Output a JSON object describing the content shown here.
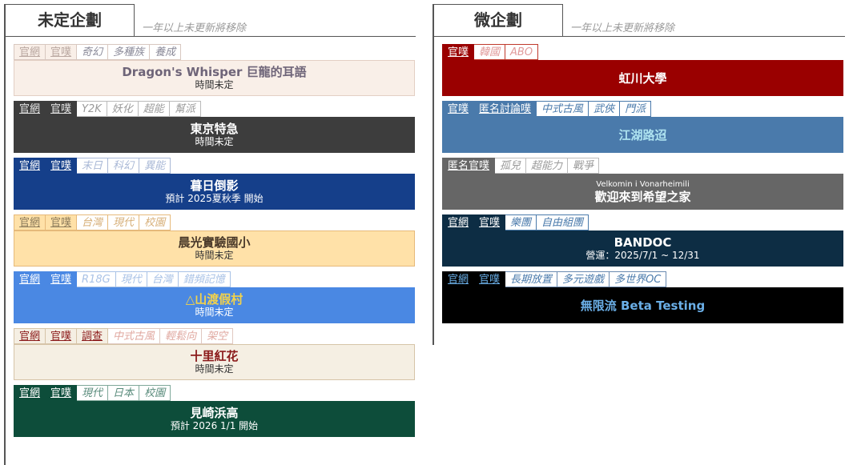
{
  "left": {
    "title": "未定企劃",
    "note": "一年以上未更新將移除",
    "cards": [
      {
        "tags": [
          {
            "label": "官網",
            "kind": "link",
            "bg": "#f9efe8",
            "fg": "#b9a7a0",
            "border": "#d8c8c0"
          },
          {
            "label": "官噗",
            "kind": "link",
            "bg": "#f9efe8",
            "fg": "#b9a7a0",
            "border": "#d8c8c0"
          },
          {
            "label": "奇幻",
            "kind": "genre",
            "bg": "#ffffff",
            "fg": "#8a8a99",
            "border": "#d8c8c0"
          },
          {
            "label": "多種族",
            "kind": "genre",
            "bg": "#ffffff",
            "fg": "#8a8a99",
            "border": "#d8c8c0"
          },
          {
            "label": "養成",
            "kind": "genre",
            "bg": "#ffffff",
            "fg": "#8a8a99",
            "border": "#d8c8c0"
          }
        ],
        "banner": {
          "bg": "#f9efe8",
          "border": "#e3cfc4",
          "title": "Dragon's Whisper 巨龍的耳語",
          "title_color": "#6e6478",
          "sub": "時間未定",
          "sub_color": "#333"
        }
      },
      {
        "tags": [
          {
            "label": "官網",
            "kind": "link",
            "bg": "#3d3d3d",
            "fg": "#e6e6e6",
            "border": "#3d3d3d"
          },
          {
            "label": "官噗",
            "kind": "link",
            "bg": "#3d3d3d",
            "fg": "#e6e6e6",
            "border": "#3d3d3d"
          },
          {
            "label": "Y2K",
            "kind": "genre",
            "bg": "#ffffff",
            "fg": "#9a9a9a",
            "border": "#bbbbbb"
          },
          {
            "label": "妖化",
            "kind": "genre",
            "bg": "#ffffff",
            "fg": "#9a9a9a",
            "border": "#bbbbbb"
          },
          {
            "label": "超能",
            "kind": "genre",
            "bg": "#ffffff",
            "fg": "#9a9a9a",
            "border": "#bbbbbb"
          },
          {
            "label": "幫派",
            "kind": "genre",
            "bg": "#ffffff",
            "fg": "#9a9a9a",
            "border": "#bbbbbb"
          }
        ],
        "banner": {
          "bg": "#3d3d3d",
          "border": "#3d3d3d",
          "title": "東京特急",
          "title_color": "#ffffff",
          "sub": "時間未定",
          "sub_color": "#ffffff"
        }
      },
      {
        "tags": [
          {
            "label": "官網",
            "kind": "link",
            "bg": "#153f8a",
            "fg": "#ffffff",
            "border": "#153f8a"
          },
          {
            "label": "官噗",
            "kind": "link",
            "bg": "#153f8a",
            "fg": "#ffffff",
            "border": "#153f8a"
          },
          {
            "label": "末日",
            "kind": "genre",
            "bg": "#ffffff",
            "fg": "#a9b8d6",
            "border": "#a9b8d6"
          },
          {
            "label": "科幻",
            "kind": "genre",
            "bg": "#ffffff",
            "fg": "#a9b8d6",
            "border": "#a9b8d6"
          },
          {
            "label": "異能",
            "kind": "genre",
            "bg": "#ffffff",
            "fg": "#a9b8d6",
            "border": "#a9b8d6"
          }
        ],
        "banner": {
          "bg": "#153f8a",
          "border": "#153f8a",
          "title": "暮日倒影",
          "title_color": "#ffffff",
          "sub": "預計 2025夏秋季 開始",
          "sub_color": "#ffffff"
        }
      },
      {
        "tags": [
          {
            "label": "官網",
            "kind": "link",
            "bg": "#ffe1a8",
            "fg": "#8a7a5a",
            "border": "#e6b97a"
          },
          {
            "label": "官噗",
            "kind": "link",
            "bg": "#ffe1a8",
            "fg": "#8a7a5a",
            "border": "#e6b97a"
          },
          {
            "label": "台灣",
            "kind": "genre",
            "bg": "#ffffff",
            "fg": "#d7b07a",
            "border": "#e6b97a"
          },
          {
            "label": "現代",
            "kind": "genre",
            "bg": "#ffffff",
            "fg": "#d7b07a",
            "border": "#e6b97a"
          },
          {
            "label": "校園",
            "kind": "genre",
            "bg": "#ffffff",
            "fg": "#d7b07a",
            "border": "#e6b97a"
          }
        ],
        "banner": {
          "bg": "#ffe1a8",
          "border": "#e6b97a",
          "title": "晨光實驗國小",
          "title_color": "#4a3a2a",
          "sub": "時間未定",
          "sub_color": "#333333"
        }
      },
      {
        "tags": [
          {
            "label": "官網",
            "kind": "link",
            "bg": "#4a88e3",
            "fg": "#ffffff",
            "border": "#4a88e3"
          },
          {
            "label": "官噗",
            "kind": "link",
            "bg": "#4a88e3",
            "fg": "#ffffff",
            "border": "#4a88e3"
          },
          {
            "label": "R18G",
            "kind": "genre",
            "bg": "#ffffff",
            "fg": "#a9c2e6",
            "border": "#a9c2e6"
          },
          {
            "label": "現代",
            "kind": "genre",
            "bg": "#ffffff",
            "fg": "#a9c2e6",
            "border": "#a9c2e6"
          },
          {
            "label": "台灣",
            "kind": "genre",
            "bg": "#ffffff",
            "fg": "#a9c2e6",
            "border": "#a9c2e6"
          },
          {
            "label": "錯頻記憶",
            "kind": "genre",
            "bg": "#ffffff",
            "fg": "#a9c2e6",
            "border": "#a9c2e6"
          }
        ],
        "banner": {
          "bg": "#4a88e3",
          "border": "#4a88e3",
          "title": "△山渡假村",
          "title_color": "#f3d24a",
          "sub": "時間未定",
          "sub_color": "#ffffff"
        }
      },
      {
        "tags": [
          {
            "label": "官網",
            "kind": "link",
            "bg": "#f5efe3",
            "fg": "#8b1a1a",
            "border": "#d6c4a8"
          },
          {
            "label": "官噗",
            "kind": "link",
            "bg": "#f5efe3",
            "fg": "#8b1a1a",
            "border": "#d6c4a8"
          },
          {
            "label": "調查",
            "kind": "link",
            "bg": "#f5efe3",
            "fg": "#8b1a1a",
            "border": "#d6c4a8"
          },
          {
            "label": "中式古風",
            "kind": "genre",
            "bg": "#ffffff",
            "fg": "#e0a8a0",
            "border": "#e0c8c0"
          },
          {
            "label": "輕鬆向",
            "kind": "genre",
            "bg": "#ffffff",
            "fg": "#e0a8a0",
            "border": "#e0c8c0"
          },
          {
            "label": "架空",
            "kind": "genre",
            "bg": "#ffffff",
            "fg": "#e0a8a0",
            "border": "#e0c8c0"
          }
        ],
        "banner": {
          "bg": "#f5efe3",
          "border": "#d6c4a8",
          "title": "十里紅花",
          "title_color": "#8b1a1a",
          "sub": "時間未定",
          "sub_color": "#333333"
        }
      },
      {
        "tags": [
          {
            "label": "官網",
            "kind": "link",
            "bg": "#0d4d3a",
            "fg": "#ffffff",
            "border": "#0d4d3a"
          },
          {
            "label": "官噗",
            "kind": "link",
            "bg": "#0d4d3a",
            "fg": "#ffffff",
            "border": "#0d4d3a"
          },
          {
            "label": "現代",
            "kind": "genre",
            "bg": "#ffffff",
            "fg": "#5a8c7c",
            "border": "#7fa89a"
          },
          {
            "label": "日本",
            "kind": "genre",
            "bg": "#ffffff",
            "fg": "#5a8c7c",
            "border": "#7fa89a"
          },
          {
            "label": "校園",
            "kind": "genre",
            "bg": "#ffffff",
            "fg": "#5a8c7c",
            "border": "#7fa89a"
          }
        ],
        "banner": {
          "bg": "#0d4d3a",
          "border": "#0d4d3a",
          "title": "見崎浜高",
          "title_color": "#ffffff",
          "sub": "預計 2026 1/1 開始",
          "sub_color": "#ffffff"
        }
      }
    ]
  },
  "right": {
    "title": "微企劃",
    "note": "一年以上未更新將移除",
    "cards": [
      {
        "tags": [
          {
            "label": "官噗",
            "kind": "link",
            "bg": "#9a0000",
            "fg": "#ffffff",
            "border": "#9a0000"
          },
          {
            "label": "韓國",
            "kind": "genre",
            "bg": "#ffffff",
            "fg": "#e09a9a",
            "border": "#c0392b"
          },
          {
            "label": "ABO",
            "kind": "genre",
            "bg": "#ffffff",
            "fg": "#e09a9a",
            "border": "#c0392b"
          }
        ],
        "banner": {
          "bg": "#9a0000",
          "border": "#9a0000",
          "pre": "",
          "title": "虹川大學",
          "title_color": "#ffffff",
          "sub": "",
          "sub_color": "#ffffff"
        }
      },
      {
        "tags": [
          {
            "label": "官噗",
            "kind": "link",
            "bg": "#4a7aab",
            "fg": "#ffffff",
            "border": "#4a7aab"
          },
          {
            "label": "匿名討論噗",
            "kind": "link",
            "bg": "#4a7aab",
            "fg": "#ffffff",
            "border": "#4a7aab"
          },
          {
            "label": "中式古風",
            "kind": "genre",
            "bg": "#ffffff",
            "fg": "#4a7aab",
            "border": "#4a7aab"
          },
          {
            "label": "武俠",
            "kind": "genre",
            "bg": "#ffffff",
            "fg": "#4a7aab",
            "border": "#4a7aab"
          },
          {
            "label": "門派",
            "kind": "genre",
            "bg": "#ffffff",
            "fg": "#4a7aab",
            "border": "#4a7aab"
          }
        ],
        "banner": {
          "bg": "#4a7aab",
          "border": "#4a7aab",
          "pre": "",
          "title": "江湖路迢",
          "title_color": "#aee3f0",
          "sub": "",
          "sub_color": "#ffffff"
        }
      },
      {
        "tags": [
          {
            "label": "匿名官噗",
            "kind": "link",
            "bg": "#666666",
            "fg": "#ffffff",
            "border": "#666666"
          },
          {
            "label": "孤兒",
            "kind": "genre",
            "bg": "#ffffff",
            "fg": "#999999",
            "border": "#bbbbbb"
          },
          {
            "label": "超能力",
            "kind": "genre",
            "bg": "#ffffff",
            "fg": "#999999",
            "border": "#bbbbbb"
          },
          {
            "label": "戰爭",
            "kind": "genre",
            "bg": "#ffffff",
            "fg": "#999999",
            "border": "#bbbbbb"
          }
        ],
        "banner": {
          "bg": "#666666",
          "border": "#666666",
          "pre": "Velkomin i Vonarheimili",
          "title": "歡迎來到希望之家",
          "title_color": "#ffffff",
          "sub": "",
          "sub_color": "#ffffff"
        }
      },
      {
        "tags": [
          {
            "label": "官網",
            "kind": "link",
            "bg": "#0d2d44",
            "fg": "#ffffff",
            "border": "#0d2d44"
          },
          {
            "label": "官噗",
            "kind": "link",
            "bg": "#0d2d44",
            "fg": "#ffffff",
            "border": "#0d2d44"
          },
          {
            "label": "樂團",
            "kind": "genre",
            "bg": "#ffffff",
            "fg": "#4a7aab",
            "border": "#4a7aab"
          },
          {
            "label": "自由組團",
            "kind": "genre",
            "bg": "#ffffff",
            "fg": "#4a7aab",
            "border": "#4a7aab"
          }
        ],
        "banner": {
          "bg": "#0d2d44",
          "border": "#0d2d44",
          "pre": "",
          "title": "BANDOC",
          "title_color": "#ffffff",
          "sub": "營運：2025/7/1 ~ 12/31",
          "sub_color": "#ffffff"
        }
      },
      {
        "tags": [
          {
            "label": "官網",
            "kind": "link",
            "bg": "#000000",
            "fg": "#6aaee6",
            "border": "#000000"
          },
          {
            "label": "官噗",
            "kind": "link",
            "bg": "#000000",
            "fg": "#6aaee6",
            "border": "#000000"
          },
          {
            "label": "長期放置",
            "kind": "genre",
            "bg": "#ffffff",
            "fg": "#4a7aab",
            "border": "#6a8ab0"
          },
          {
            "label": "多元遊戲",
            "kind": "genre",
            "bg": "#ffffff",
            "fg": "#4a7aab",
            "border": "#6a8ab0"
          },
          {
            "label": "多世界OC",
            "kind": "genre",
            "bg": "#ffffff",
            "fg": "#4a7aab",
            "border": "#6a8ab0"
          }
        ],
        "banner": {
          "bg": "#000000",
          "border": "#000000",
          "pre": "",
          "title": "無限流 Beta Testing",
          "title_color": "#6aaee6",
          "sub": "",
          "sub_color": "#ffffff"
        }
      }
    ]
  }
}
